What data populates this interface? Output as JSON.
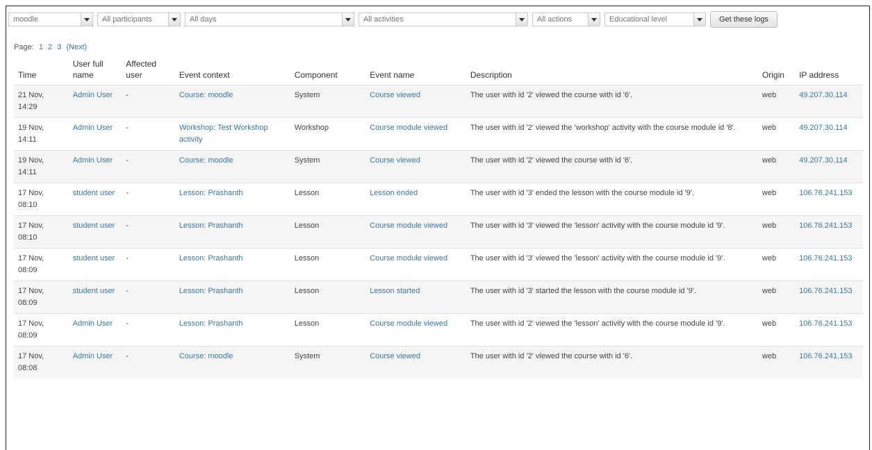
{
  "filters": {
    "course": "moodle",
    "participants": "All participants",
    "days": "All days",
    "activities": "All activities",
    "actions": "All actions",
    "level": "Educational level",
    "submit": "Get these logs"
  },
  "paging": {
    "label": "Page:",
    "pages": [
      "1",
      "2",
      "3"
    ],
    "next": "(Next)"
  },
  "table": {
    "headers": [
      "Time",
      "User full name",
      "Affected user",
      "Event context",
      "Component",
      "Event name",
      "Description",
      "Origin",
      "IP address"
    ],
    "rows": [
      {
        "time": "21 Nov, 14:29",
        "user": "Admin User",
        "affected": "-",
        "context": "Course: moodle",
        "component": "System",
        "event": "Course viewed",
        "description": "The user with id '2' viewed the course with id '6'.",
        "origin": "web",
        "ip": "49.207.30.114"
      },
      {
        "time": "19 Nov, 14:11",
        "user": "Admin User",
        "affected": "-",
        "context": "Workshop: Test Workshop activity",
        "component": "Workshop",
        "event": "Course module viewed",
        "description": "The user with id '2' viewed the 'workshop' activity with the course module id '8'.",
        "origin": "web",
        "ip": "49.207.30.114"
      },
      {
        "time": "19 Nov, 14:11",
        "user": "Admin User",
        "affected": "-",
        "context": "Course: moodle",
        "component": "System",
        "event": "Course viewed",
        "description": "The user with id '2' viewed the course with id '6'.",
        "origin": "web",
        "ip": "49.207.30.114"
      },
      {
        "time": "17 Nov, 08:10",
        "user": "student user",
        "affected": "-",
        "context": "Lesson: Prashanth",
        "component": "Lesson",
        "event": "Lesson ended",
        "description": "The user with id '3' ended the lesson with the course module id '9'.",
        "origin": "web",
        "ip": "106.76.241.153"
      },
      {
        "time": "17 Nov, 08:10",
        "user": "student user",
        "affected": "-",
        "context": "Lesson: Prashanth",
        "component": "Lesson",
        "event": "Course module viewed",
        "description": "The user with id '3' viewed the 'lesson' activity with the course module id '9'.",
        "origin": "web",
        "ip": "106.76.241.153"
      },
      {
        "time": "17 Nov, 08:09",
        "user": "student user",
        "affected": "-",
        "context": "Lesson: Prashanth",
        "component": "Lesson",
        "event": "Course module viewed",
        "description": "The user with id '3' viewed the 'lesson' activity with the course module id '9'.",
        "origin": "web",
        "ip": "106.76.241.153"
      },
      {
        "time": "17 Nov, 08:09",
        "user": "student user",
        "affected": "-",
        "context": "Lesson: Prashanth",
        "component": "Lesson",
        "event": "Lesson started",
        "description": "The user with id '3' started the lesson with the course module id '9'.",
        "origin": "web",
        "ip": "106.76.241.153"
      },
      {
        "time": "17 Nov, 08:09",
        "user": "Admin User",
        "affected": "-",
        "context": "Lesson: Prashanth",
        "component": "Lesson",
        "event": "Course module viewed",
        "description": "The user with id '2' viewed the 'lesson' activity with the course module id '9'.",
        "origin": "web",
        "ip": "106.76.241.153"
      },
      {
        "time": "17 Nov, 08:08",
        "user": "Admin User",
        "affected": "-",
        "context": "Course: moodle",
        "component": "System",
        "event": "Course viewed",
        "description": "The user with id '2' viewed the course with id '6'.",
        "origin": "web",
        "ip": "106.76.241.153"
      }
    ]
  },
  "colors": {
    "link": "#3a77a8",
    "row_alt": "#f5f5f5",
    "border": "#e2e2e2"
  }
}
